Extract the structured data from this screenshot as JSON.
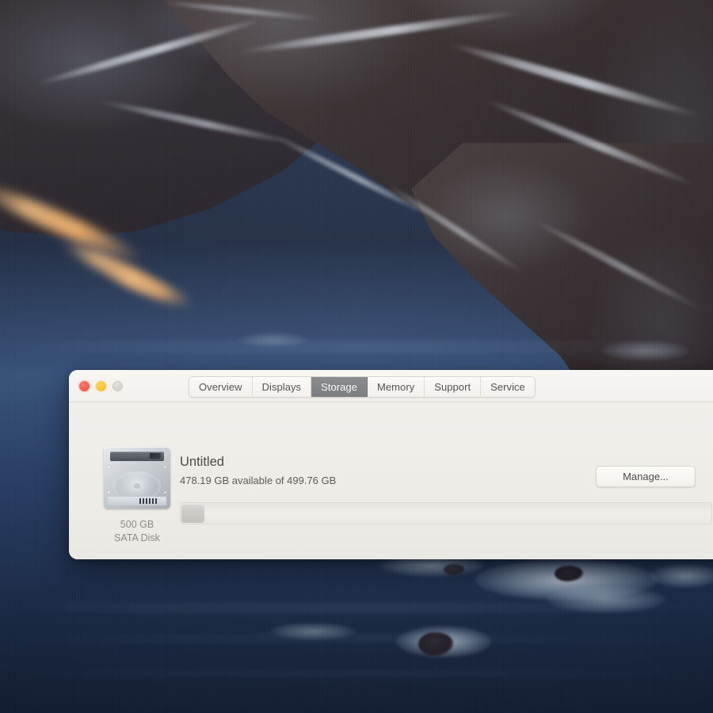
{
  "desktop": {
    "wallpaper_name": "big-sur-cliffs-ocean",
    "colors": {
      "ocean_deep": "#14233f",
      "ocean_mid": "#33507c",
      "rock_dark": "#241f26",
      "glow_orange": "#ffc184",
      "foam_white": "#dee9f8"
    }
  },
  "window": {
    "app": "About This Mac",
    "traffic_lights": [
      {
        "name": "close",
        "color": "#ef4a3c",
        "enabled": true
      },
      {
        "name": "minimize",
        "color": "#f5b92a",
        "enabled": true
      },
      {
        "name": "zoom",
        "color": "#cfcdc8",
        "enabled": false
      }
    ],
    "tabs": [
      {
        "label": "Overview",
        "selected": false
      },
      {
        "label": "Displays",
        "selected": false
      },
      {
        "label": "Storage",
        "selected": true
      },
      {
        "label": "Memory",
        "selected": false
      },
      {
        "label": "Support",
        "selected": false
      },
      {
        "label": "Service",
        "selected": false
      }
    ],
    "selected_tab": "Storage"
  },
  "storage": {
    "disk": {
      "icon": "hard-disk-icon",
      "capacity_label": "500 GB",
      "type_label": "SATA Disk"
    },
    "volume_name": "Untitled",
    "availability_text": "478.19 GB available of 499.76 GB",
    "available_gb": 478.19,
    "total_gb": 499.76,
    "used_gb": 21.57,
    "used_percent": 4.3,
    "manage_button_label": "Manage...",
    "bar_used_color": "#cbcac6",
    "bar_track_color": "#efeeea"
  }
}
